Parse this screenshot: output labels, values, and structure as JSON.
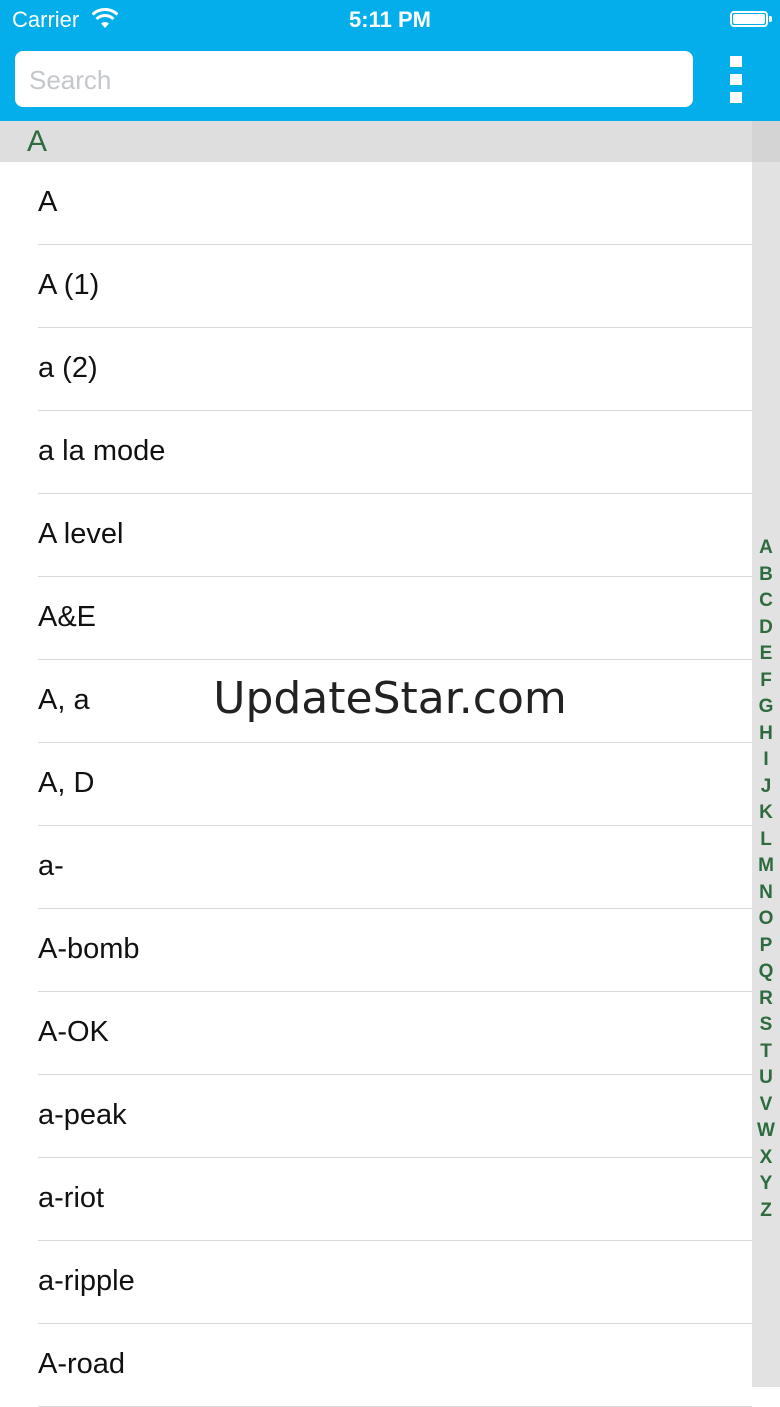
{
  "status_bar": {
    "carrier": "Carrier",
    "time": "5:11 PM",
    "icons": [
      "wifi-icon",
      "battery-icon"
    ]
  },
  "search": {
    "placeholder": "Search"
  },
  "menu": {
    "icon": "more-vertical-icon"
  },
  "section": {
    "letter": "A"
  },
  "entries": [
    "A",
    "A (1)",
    "a (2)",
    "a la mode",
    "A level",
    "A&E",
    "A, a",
    "A, D",
    "a-",
    "A-bomb",
    "A-OK",
    "a-peak",
    "a-riot",
    "a-ripple",
    "A-road"
  ],
  "index_letters": [
    "A",
    "B",
    "C",
    "D",
    "E",
    "F",
    "G",
    "H",
    "I",
    "J",
    "K",
    "L",
    "M",
    "N",
    "O",
    "P",
    "Q",
    "R",
    "S",
    "T",
    "U",
    "V",
    "W",
    "X",
    "Y",
    "Z"
  ],
  "watermark": "UpdateStar.com",
  "colors": {
    "accent": "#03aeea",
    "index_text": "#2e6b3e",
    "section_bg": "#dedede"
  }
}
